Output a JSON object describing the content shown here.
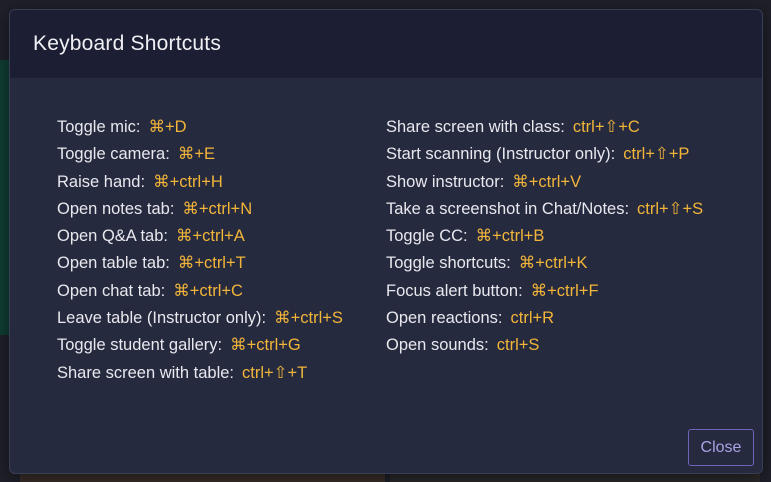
{
  "modal": {
    "title": "Keyboard Shortcuts",
    "close_label": "Close"
  },
  "shortcuts_left": [
    {
      "label": "Toggle mic:",
      "keys": "⌘+D"
    },
    {
      "label": "Toggle camera:",
      "keys": "⌘+E"
    },
    {
      "label": "Raise hand:",
      "keys": "⌘+ctrl+H"
    },
    {
      "label": "Open notes tab:",
      "keys": "⌘+ctrl+N"
    },
    {
      "label": "Open Q&A tab:",
      "keys": "⌘+ctrl+A"
    },
    {
      "label": "Open table tab:",
      "keys": "⌘+ctrl+T"
    },
    {
      "label": "Open chat tab:",
      "keys": "⌘+ctrl+C"
    },
    {
      "label": "Leave table (Instructor only):",
      "keys": "⌘+ctrl+S"
    },
    {
      "label": "Toggle student gallery:",
      "keys": "⌘+ctrl+G"
    },
    {
      "label": "Share screen with table:",
      "keys": "ctrl+⇧+T"
    }
  ],
  "shortcuts_right": [
    {
      "label": "Share screen with class:",
      "keys": "ctrl+⇧+C"
    },
    {
      "label": "Start scanning (Instructor only):",
      "keys": "ctrl+⇧+P"
    },
    {
      "label": "Show instructor:",
      "keys": "⌘+ctrl+V"
    },
    {
      "label": "Take a screenshot in Chat/Notes:",
      "keys": "ctrl+⇧+S"
    },
    {
      "label": "Toggle CC:",
      "keys": "⌘+ctrl+B"
    },
    {
      "label": "Toggle shortcuts:",
      "keys": "⌘+ctrl+K"
    },
    {
      "label": "Focus alert button:",
      "keys": "⌘+ctrl+F"
    },
    {
      "label": "Open reactions:",
      "keys": "ctrl+R"
    },
    {
      "label": "Open sounds:",
      "keys": "ctrl+S"
    }
  ],
  "colors": {
    "key_accent": "#f2b53a",
    "close_button": "#a9a2e6"
  }
}
